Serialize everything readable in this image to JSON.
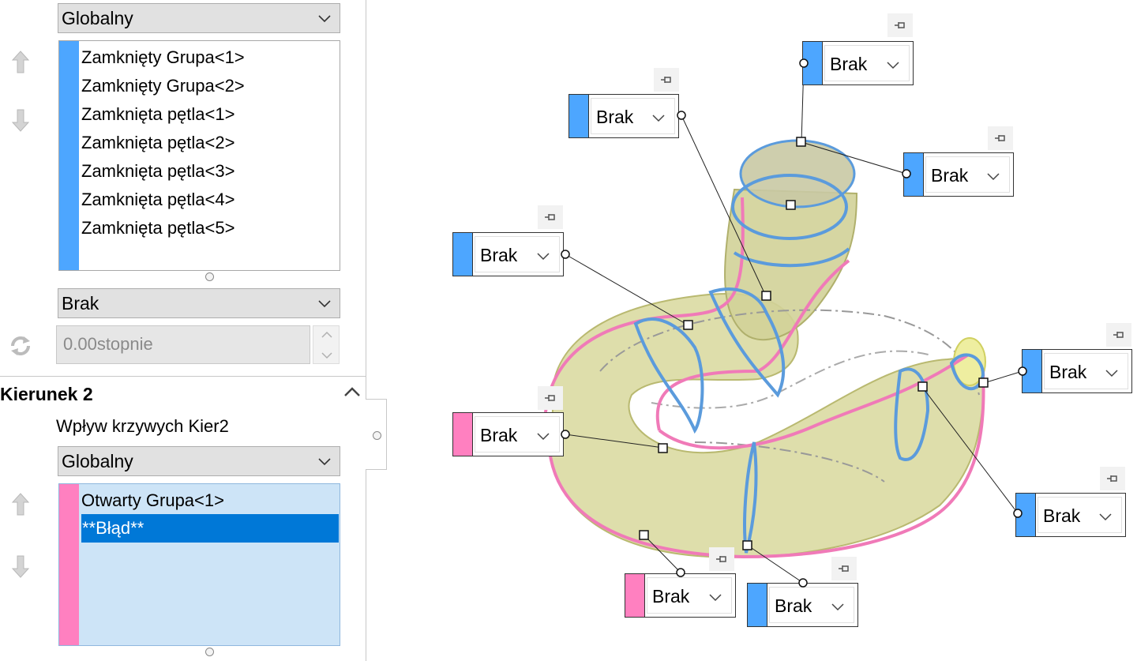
{
  "direction1": {
    "influence_combo": "Globalny",
    "items": [
      "Zamknięty Grupa<1>",
      "Zamknięty Grupa<2>",
      "Zamknięta pętla<1>",
      "Zamknięta pętla<2>",
      "Zamknięta pętla<3>",
      "Zamknięta pętla<4>",
      "Zamknięta pętla<5>"
    ],
    "tangency_combo": "Brak",
    "angle_value": "0.00stopnie",
    "color": "#4da6ff"
  },
  "direction2": {
    "title": "Kierunek 2",
    "influence_label": "Wpływ krzywych Kier2",
    "influence_combo": "Globalny",
    "items": [
      "Otwarty Grupa<1>",
      "**Błąd**"
    ],
    "color": "#ff80c0"
  },
  "callouts": [
    {
      "label": "Brak",
      "color": "#4da6ff"
    },
    {
      "label": "Brak",
      "color": "#4da6ff"
    },
    {
      "label": "Brak",
      "color": "#4da6ff"
    },
    {
      "label": "Brak",
      "color": "#4da6ff"
    },
    {
      "label": "Brak",
      "color": "#4da6ff"
    },
    {
      "label": "Brak",
      "color": "#ff80c0"
    },
    {
      "label": "Brak",
      "color": "#4da6ff"
    },
    {
      "label": "Brak",
      "color": "#ff80c0"
    },
    {
      "label": "Brak",
      "color": "#4da6ff"
    }
  ],
  "colors": {
    "surface": "#d6d69a",
    "selection": "#0078d7",
    "blue_curve": "#5b9bdc",
    "pink_curve": "#f07ab8"
  }
}
